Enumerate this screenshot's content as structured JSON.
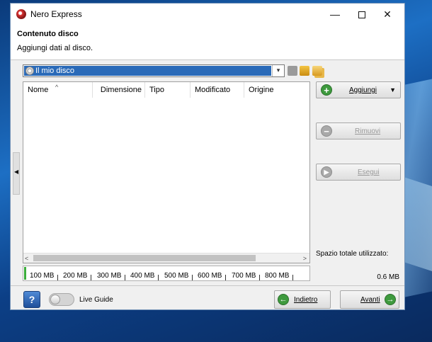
{
  "window": {
    "title": "Nero Express",
    "controls": {
      "minimize": "—",
      "close": "✕"
    }
  },
  "header": {
    "title": "Contenuto disco",
    "subtitle": "Aggiungi dati al disco."
  },
  "disc_selector": {
    "value": "Il mio disco",
    "arrow": "▾"
  },
  "file_list": {
    "sort_indicator": "^",
    "columns": [
      "Nome",
      "Dimensione",
      "Tipo",
      "Modificato",
      "Origine"
    ],
    "rows": [],
    "scroll_left": "<",
    "scroll_right": ">"
  },
  "side_panel_handle": "◀",
  "actions": {
    "add_label": "Aggiungi",
    "add_dropdown": "▼",
    "remove_label": "Rimuovi",
    "run_label": "Esegui"
  },
  "capacity": {
    "labels": [
      "100 MB",
      "200 MB",
      "300 MB",
      "400 MB",
      "500 MB",
      "600 MB",
      "700 MB",
      "800 MB"
    ],
    "max_mb": 850,
    "used_mb": 0.6
  },
  "stats": {
    "total_used_label": "Spazio totale utilizzato:",
    "total_used_value": "0.6 MB"
  },
  "footer": {
    "help_label": "?",
    "live_guide_label": "Live Guide",
    "back_label": "Indietro",
    "next_label": "Avanti"
  },
  "colors": {
    "selection": "#2a6ab8",
    "capacity_fill": "#3cae3c",
    "add_icon": "#3e9a3e",
    "nav_icon": "#3e9a3e",
    "help_button": "#2a5fae"
  },
  "icons": {
    "app": "nero-icon",
    "disc": "disc-icon",
    "add": "plus-icon",
    "remove": "minus-icon",
    "run": "play-icon",
    "back": "arrow-left-icon",
    "next": "arrow-right-icon"
  }
}
